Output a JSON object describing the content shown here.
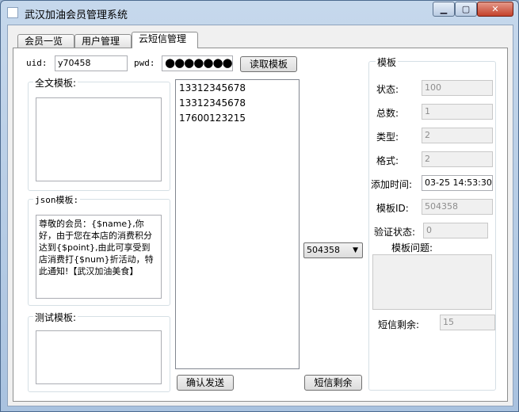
{
  "window": {
    "title": "武汉加油会员管理系统"
  },
  "tabs": [
    {
      "label": "会员一览"
    },
    {
      "label": "用户管理"
    },
    {
      "label": "云短信管理"
    }
  ],
  "auth": {
    "uid_label": "uid:",
    "uid_value": "y70458",
    "pwd_label": "pwd:",
    "pwd_value": "●●●●●●●●",
    "read_template_label": "读取模板"
  },
  "groups": {
    "fulltext_title": "全文模板:",
    "json_title": "json模板:",
    "json_text": "尊敬的会员：{$name},你好，由于您在本店的消费积分达到{$point},由此可享受到店消费打{$num}折活动，特此通知!【武汉加油美食】",
    "test_title": "测试模板:"
  },
  "phone_list": [
    "13312345678",
    "13312345678",
    "17600123215"
  ],
  "template_select": {
    "value": "504358"
  },
  "actions": {
    "confirm_send": "确认发送",
    "sms_remaining": "短信剩余"
  },
  "template_panel": {
    "title": "模板",
    "status_label": "状态:",
    "status_value": "100",
    "total_label": "总数:",
    "total_value": "1",
    "type_label": "类型:",
    "type_value": "2",
    "format_label": "格式:",
    "format_value": "2",
    "added_time_label": "添加时间:",
    "added_time_value": "03-25 14:53:30",
    "template_id_label": "模板ID:",
    "template_id_value": "504358",
    "verify_status_label": "验证状态:",
    "verify_status_value": "0",
    "issue_label": "模板问题:",
    "sms_left_label": "短信剩余:",
    "sms_left_value": "15"
  },
  "colors": {
    "title_bar": "#b9cde5",
    "close_button": "#c4412b"
  }
}
